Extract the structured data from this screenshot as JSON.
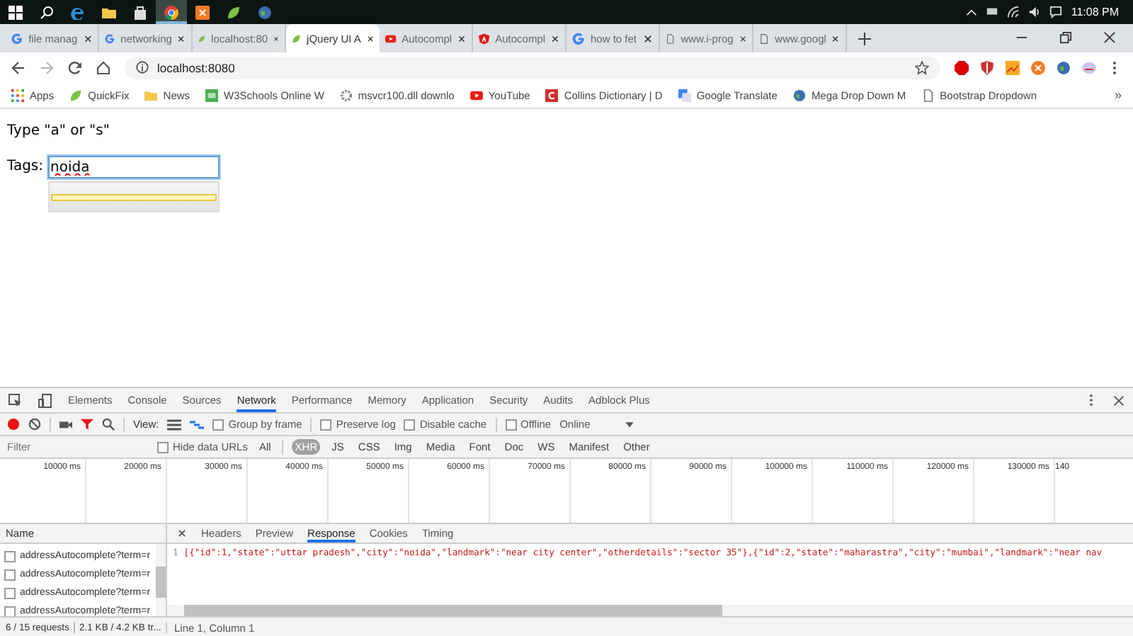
{
  "taskbar": {
    "apps": [
      {
        "kind": "start",
        "selected": false
      },
      {
        "kind": "search",
        "selected": false
      },
      {
        "kind": "edge",
        "selected": false
      },
      {
        "kind": "folder",
        "selected": false
      },
      {
        "kind": "store",
        "selected": false
      },
      {
        "kind": "chrome",
        "selected": true
      },
      {
        "kind": "xampp",
        "selected": false
      },
      {
        "kind": "leaf",
        "selected": false
      },
      {
        "kind": "globe",
        "selected": false
      }
    ],
    "clock": "11:08 PM"
  },
  "browser_tabs": [
    {
      "title": "file manag",
      "kind": "google",
      "selected": false
    },
    {
      "title": "networking",
      "kind": "google",
      "selected": false
    },
    {
      "title": "localhost:80",
      "kind": "leaf",
      "selected": false
    },
    {
      "title": "jQuery UI A",
      "kind": "leaf",
      "selected": true
    },
    {
      "title": "Autocompl",
      "kind": "youtube",
      "selected": false
    },
    {
      "title": "Autocompl",
      "kind": "angular",
      "selected": false
    },
    {
      "title": "how to fet",
      "kind": "google",
      "selected": false
    },
    {
      "title": "www.i-prog",
      "kind": "page",
      "selected": false
    },
    {
      "title": "www.googl",
      "kind": "page",
      "selected": false
    }
  ],
  "address_bar": {
    "value": "localhost:8080"
  },
  "bookmarks": [
    {
      "label": "Apps",
      "kind": "grid"
    },
    {
      "label": "QuickFix",
      "kind": "leaf"
    },
    {
      "label": "News",
      "kind": "folder"
    },
    {
      "label": "W3Schools Online W",
      "kind": "w3"
    },
    {
      "label": "msvcr100.dll downlo",
      "kind": "gear"
    },
    {
      "label": "YouTube",
      "kind": "youtube"
    },
    {
      "label": "Collins Dictionary | D",
      "kind": "collins"
    },
    {
      "label": "Google Translate",
      "kind": "translate"
    },
    {
      "label": "Mega Drop Down M",
      "kind": "globe"
    },
    {
      "label": "Bootstrap Dropdown",
      "kind": "page"
    }
  ],
  "bookmarks_more": "»",
  "page": {
    "heading": "Type \"a\" or \"s\"",
    "tags_label": "Tags:",
    "tags_value": "noida"
  },
  "devtools": {
    "tabs": [
      {
        "label": "Elements",
        "selected": false
      },
      {
        "label": "Console",
        "selected": false
      },
      {
        "label": "Sources",
        "selected": false
      },
      {
        "label": "Network",
        "selected": true
      },
      {
        "label": "Performance",
        "selected": false
      },
      {
        "label": "Memory",
        "selected": false
      },
      {
        "label": "Application",
        "selected": false
      },
      {
        "label": "Security",
        "selected": false
      },
      {
        "label": "Audits",
        "selected": false
      },
      {
        "label": "Adblock Plus",
        "selected": false
      }
    ],
    "toolbar": {
      "view_label": "View:",
      "checks": [
        {
          "label": "Group by frame",
          "checked": false
        },
        {
          "label": "Preserve log",
          "checked": false
        },
        {
          "label": "Disable cache",
          "checked": false
        },
        {
          "label": "Offline",
          "checked": false
        }
      ],
      "throttle": "Online"
    },
    "filter": {
      "placeholder": "Filter",
      "hide_data_urls": {
        "label": "Hide data URLs",
        "checked": false
      },
      "types": [
        {
          "label": "All",
          "selected": false
        },
        {
          "label": "XHR",
          "selected": true
        },
        {
          "label": "JS",
          "selected": false
        },
        {
          "label": "CSS",
          "selected": false
        },
        {
          "label": "Img",
          "selected": false
        },
        {
          "label": "Media",
          "selected": false
        },
        {
          "label": "Font",
          "selected": false
        },
        {
          "label": "Doc",
          "selected": false
        },
        {
          "label": "WS",
          "selected": false
        },
        {
          "label": "Manifest",
          "selected": false
        },
        {
          "label": "Other",
          "selected": false
        }
      ]
    },
    "timeline_ticks": [
      "10000 ms",
      "20000 ms",
      "30000 ms",
      "40000 ms",
      "50000 ms",
      "60000 ms",
      "70000 ms",
      "80000 ms",
      "90000 ms",
      "100000 ms",
      "110000 ms",
      "120000 ms",
      "130000 ms",
      "140"
    ],
    "requests": {
      "header": "Name",
      "rows": [
        {
          "name": "addressAutocomplete?term=r",
          "checked": false
        },
        {
          "name": "addressAutocomplete?term=r",
          "checked": false
        },
        {
          "name": "addressAutocomplete?term=r",
          "checked": false
        },
        {
          "name": "addressAutocomplete?term=r",
          "checked": false
        }
      ]
    },
    "detail_tabs": [
      {
        "label": "Headers",
        "selected": false
      },
      {
        "label": "Preview",
        "selected": false
      },
      {
        "label": "Response",
        "selected": true
      },
      {
        "label": "Cookies",
        "selected": false
      },
      {
        "label": "Timing",
        "selected": false
      }
    ],
    "response": {
      "line_number": "1",
      "text": "[{\"id\":1,\"state\":\"uttar pradesh\",\"city\":\"noida\",\"landmark\":\"near city center\",\"otherdetails\":\"sector 35\"},{\"id\":2,\"state\":\"maharastra\",\"city\":\"mumbai\",\"landmark\":\"near nav"
    },
    "status": {
      "requests": "6 / 15 requests",
      "transferred": "2.1 KB / 4.2 KB tr...",
      "cursor": "Line 1, Column 1"
    }
  }
}
